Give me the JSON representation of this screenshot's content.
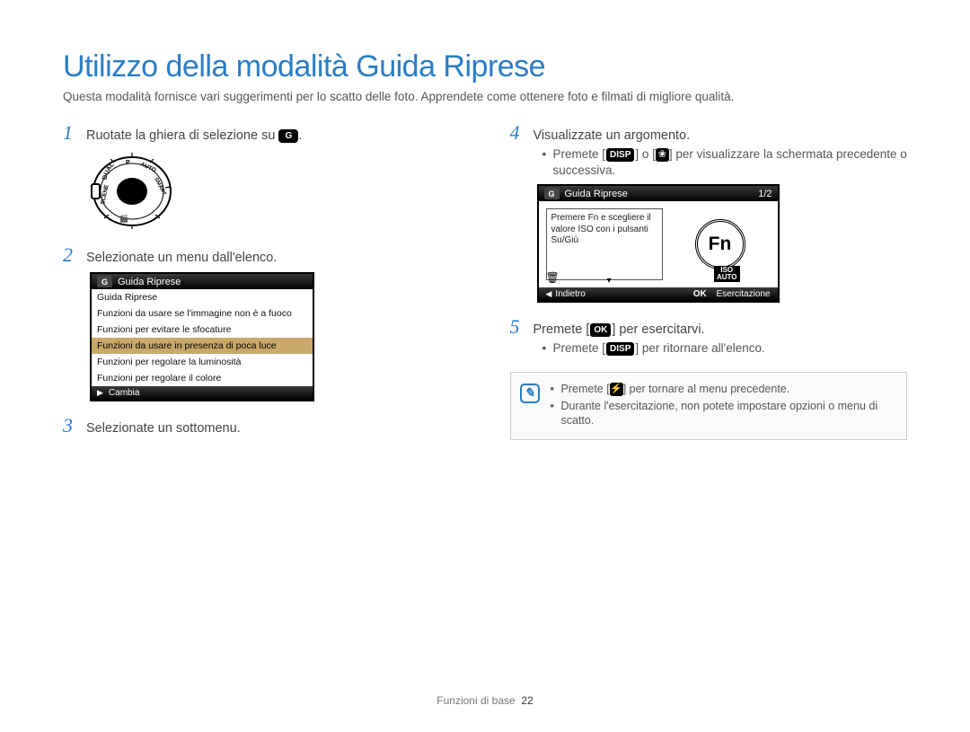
{
  "title": "Utilizzo della modalità Guida Riprese",
  "intro": "Questa modalità fornisce vari suggerimenti per lo scatto delle foto. Apprendete come ottenere foto e filmati di migliore qualità.",
  "steps": {
    "s1": "Ruotate la ghiera di selezione su",
    "s2": "Selezionate un menu dall'elenco.",
    "s3": "Selezionate un sottomenu.",
    "s4": "Visualizzate un argomento.",
    "s4_bullet": "per visualizzare la schermata precedente o successiva.",
    "s4_prefix": "Premete [",
    "s4_mid": "] o [",
    "s5_prefix": "Premete [",
    "s5_suffix": "] per esercitarvi.",
    "s5_bullet_prefix": "Premete [",
    "s5_bullet_suffix": "] per ritornare all'elenco."
  },
  "lcd1": {
    "header": "Guida Riprese",
    "rows": [
      "Guida Riprese",
      "Funzioni da usare se l'immagine non è a fuoco",
      "Funzioni per evitare le sfocature",
      "Funzioni da usare in presenza di poca luce",
      "Funzioni per regolare la luminosità",
      "Funzioni per regolare il colore"
    ],
    "selected_index": 3,
    "footer": "Cambia"
  },
  "lcd2": {
    "header": "Guida Riprese",
    "page": "1/2",
    "instruction": "Premere Fn e scegliere il valore ISO con i pulsanti Su/Giù",
    "fn": "Fn",
    "iso": "ISO",
    "back": "Indietro",
    "ok": "OK",
    "practice": "Esercitazione"
  },
  "notes": {
    "n1_prefix": "Premete [",
    "n1_suffix": "] per tornare al menu precedente.",
    "n2": "Durante l'esercitazione, non potete impostare opzioni o menu di scatto."
  },
  "button_labels": {
    "disp": "DISP",
    "ok": "OK"
  },
  "footer": {
    "section": "Funzioni di base",
    "page": "22"
  }
}
